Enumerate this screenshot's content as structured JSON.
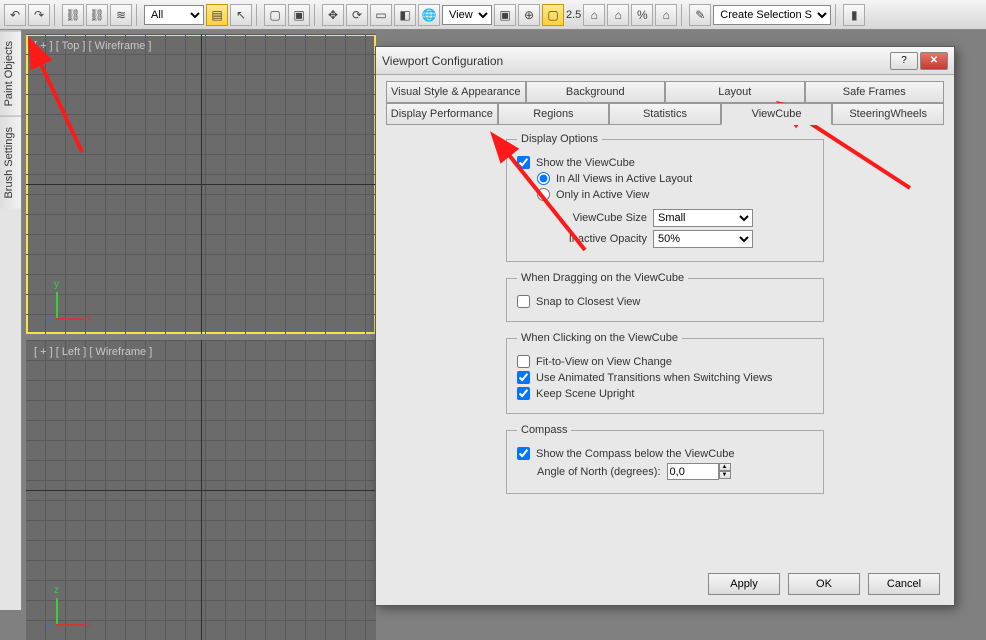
{
  "toolbar": {
    "all_dropdown": "All",
    "view_dropdown": "View",
    "pct_number": "2.5",
    "selset": "Create Selection Se"
  },
  "sidetabs": [
    "Paint Objects",
    "Brush Settings"
  ],
  "viewports": {
    "top": "[ + ] [ Top ] [ Wireframe ]",
    "left": "[ + ] [ Left ] [ Wireframe ]"
  },
  "dialog": {
    "title": "Viewport Configuration",
    "tabs_row1": [
      "Visual Style & Appearance",
      "Background",
      "Layout",
      "Safe Frames"
    ],
    "tabs_row2": [
      "Display Performance",
      "Regions",
      "Statistics",
      "ViewCube",
      "SteeringWheels"
    ],
    "display_options": {
      "legend": "Display Options",
      "show_viewcube": "Show the ViewCube",
      "in_all": "In All Views in Active Layout",
      "only_active": "Only in Active View",
      "size_label": "ViewCube Size",
      "size_value": "Small",
      "opacity_label": "Inactive Opacity",
      "opacity_value": "50%"
    },
    "when_dragging": {
      "legend": "When Dragging on the ViewCube",
      "snap": "Snap to Closest View"
    },
    "when_clicking": {
      "legend": "When Clicking on the ViewCube",
      "fit": "Fit-to-View on View Change",
      "anim": "Use Animated Transitions when Switching Views",
      "upright": "Keep Scene Upright"
    },
    "compass": {
      "legend": "Compass",
      "show": "Show the Compass below the ViewCube",
      "angle_label": "Angle of North (degrees):",
      "angle_value": "0,0"
    },
    "buttons": {
      "apply": "Apply",
      "ok": "OK",
      "cancel": "Cancel"
    }
  }
}
